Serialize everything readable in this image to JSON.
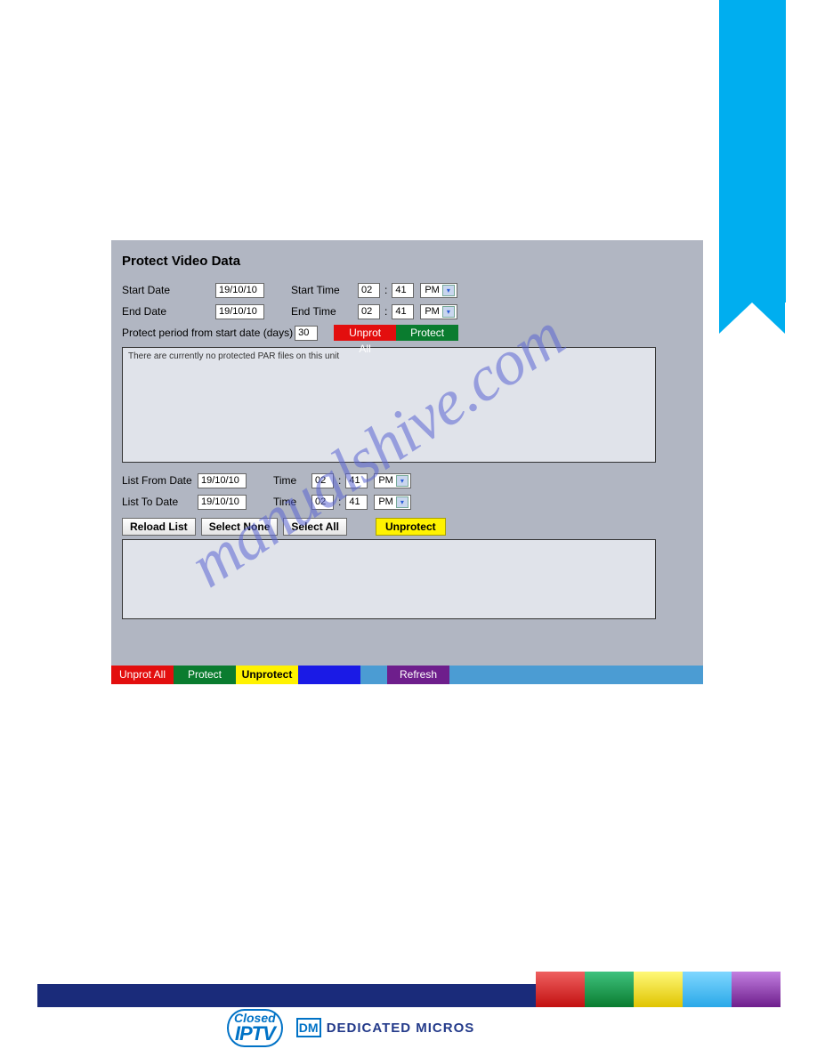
{
  "watermark": "manualshive.com",
  "panel": {
    "title": "Protect Video Data",
    "row1": {
      "start_date_label": "Start Date",
      "start_date": "19/10/10",
      "start_time_label": "Start Time",
      "start_hh": "02",
      "start_mm": "41",
      "start_ampm": "PM"
    },
    "row2": {
      "end_date_label": "End Date",
      "end_date": "19/10/10",
      "end_time_label": "End Time",
      "end_hh": "02",
      "end_mm": "41",
      "end_ampm": "PM"
    },
    "row3": {
      "period_label": "Protect period from start date (days)",
      "period_days": "30",
      "unprot_all": "Unprot All",
      "protect": "Protect"
    },
    "listbox1_msg": "There are currently no protected PAR files on this unit",
    "sec2": {
      "from_label": "List From Date",
      "from_date": "19/10/10",
      "from_time_label": "Time",
      "from_hh": "02",
      "from_mm": "41",
      "from_ampm": "PM",
      "to_label": "List To Date",
      "to_date": "19/10/10",
      "to_time_label": "Time",
      "to_hh": "02",
      "to_mm": "41",
      "to_ampm": "PM"
    },
    "buttons": {
      "reload": "Reload List",
      "select_none": "Select None",
      "select_all": "Select All",
      "unprotect": "Unprotect"
    },
    "actionbar": {
      "unprot_all": "Unprot All",
      "protect": "Protect",
      "unprotect": "Unprotect",
      "refresh": "Refresh"
    }
  },
  "footer": {
    "iptv_top": "Closed",
    "iptv_bottom": "IPTV",
    "dm_mark": "DM",
    "dm_text": "DEDICATED MICROS"
  }
}
